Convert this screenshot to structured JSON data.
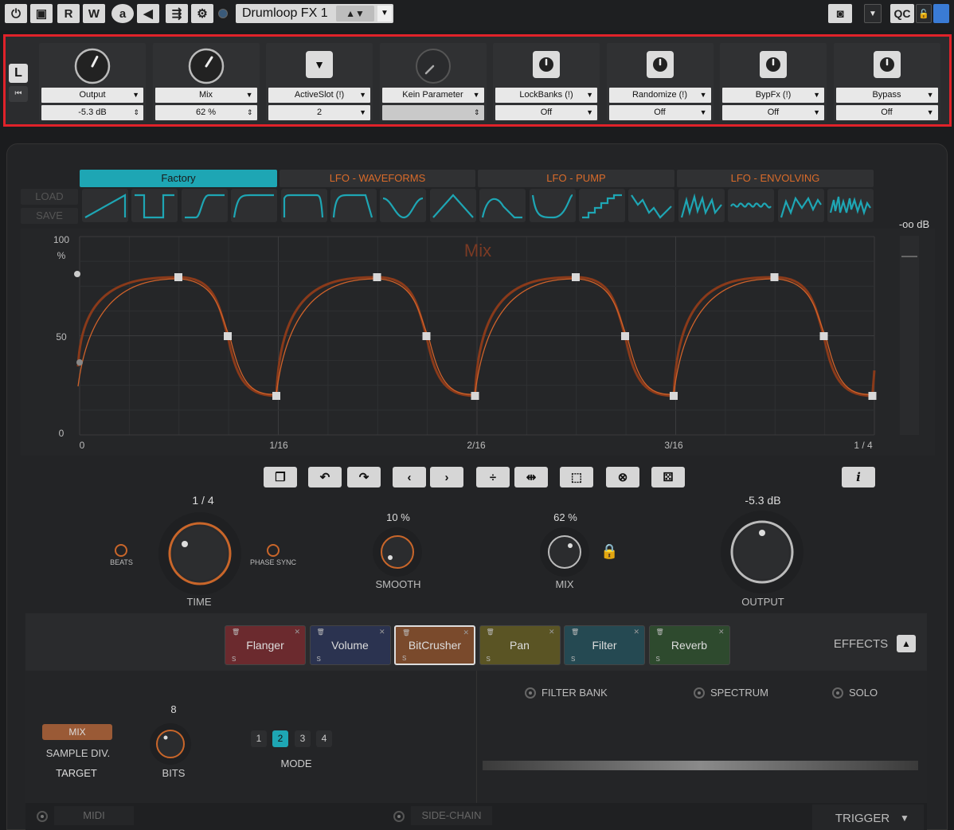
{
  "host": {
    "buttons": {
      "r": "R",
      "w": "W",
      "a": "a"
    },
    "preset_name": "Drumloop FX 1",
    "qc_label": "QC"
  },
  "quick_controls": [
    {
      "param": "Output",
      "value": "-5.3 dB",
      "control": "knob",
      "knob_level": 0.6
    },
    {
      "param": "Mix",
      "value": "62 %",
      "control": "knob",
      "knob_level": 0.62
    },
    {
      "param": "ActiveSlot (!)",
      "value": "2",
      "control": "dropdown"
    },
    {
      "param": "Kein Parameter",
      "value": "",
      "control": "knob-disabled"
    },
    {
      "param": "LockBanks (!)",
      "value": "Off",
      "control": "power"
    },
    {
      "param": "Randomize (!)",
      "value": "Off",
      "control": "power"
    },
    {
      "param": "BypFx (!)",
      "value": "Off",
      "control": "power"
    },
    {
      "param": "Bypass",
      "value": "Off",
      "control": "power"
    }
  ],
  "plugin": {
    "load": "LOAD",
    "save": "SAVE",
    "tabs": [
      "Factory",
      "LFO - WAVEFORMS",
      "LFO - PUMP",
      "LFO - ENVOLVING"
    ],
    "graph": {
      "title": "Mix",
      "y_labels": [
        "100",
        "%",
        "50",
        "0"
      ],
      "x_labels": [
        "0",
        "1/16",
        "2/16",
        "3/16",
        "1 / 4"
      ],
      "meter_label": "-oo dB"
    },
    "controls": {
      "time_value": "1 / 4",
      "time_label": "TIME",
      "beats_label": "BEATS",
      "phase_sync_label": "PHASE SYNC",
      "smooth_value": "10 %",
      "smooth_label": "SMOOTH",
      "mix_value": "62 %",
      "mix_label": "MIX",
      "output_value": "-5.3 dB",
      "output_label": "OUTPUT"
    },
    "effects": [
      {
        "name": "Flanger",
        "color": "#6b2a2e"
      },
      {
        "name": "Volume",
        "color": "#2b3350"
      },
      {
        "name": "BitCrusher",
        "color": "#7a4a2c"
      },
      {
        "name": "Pan",
        "color": "#5a5424"
      },
      {
        "name": "Filter",
        "color": "#254952"
      },
      {
        "name": "Reverb",
        "color": "#2e4a2e"
      }
    ],
    "effects_label": "EFFECTS",
    "bitcrusher": {
      "target_mix": "MIX",
      "target_sample_div": "SAMPLE DIV.",
      "target_label": "TARGET",
      "bits_value": "8",
      "bits_label": "BITS",
      "modes": [
        "1",
        "2",
        "3",
        "4"
      ],
      "mode_label": "MODE",
      "active_mode": "2"
    },
    "spectrum": {
      "filter_bank": "FILTER BANK",
      "spectrum": "SPECTRUM",
      "solo": "SOLO"
    },
    "footer": {
      "midi": "MIDI",
      "side_chain": "SIDE-CHAIN",
      "trigger": "TRIGGER"
    }
  }
}
